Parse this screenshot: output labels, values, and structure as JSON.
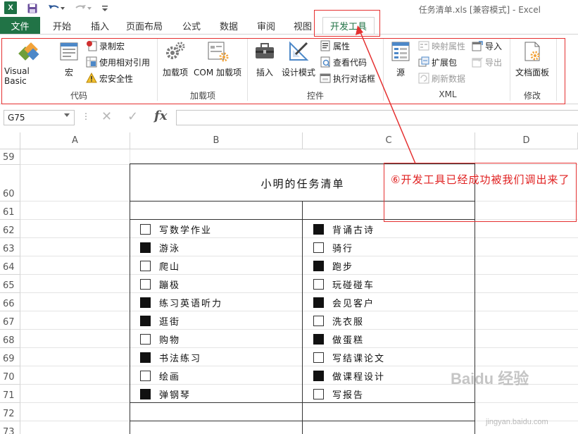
{
  "titlebar": {
    "app_logo": "X",
    "doc_title": "任务清单.xls [兼容模式] - Excel",
    "icons": [
      "save-icon",
      "undo-icon",
      "redo-icon",
      "customize-qa-icon"
    ]
  },
  "tabs": {
    "file": "文件",
    "items": [
      "开始",
      "插入",
      "页面布局",
      "公式",
      "数据",
      "审阅",
      "视图",
      "开发工具"
    ],
    "active": "开发工具"
  },
  "ribbon": {
    "groups": {
      "code": "代码",
      "addins": "加载项",
      "controls": "控件",
      "xml": "XML",
      "modify": "修改"
    },
    "visual_basic": "Visual Basic",
    "macros": "宏",
    "record_macro": "录制宏",
    "relative_ref": "使用相对引用",
    "macro_security": "宏安全性",
    "addins": "加载项",
    "com_addins": "COM 加载项",
    "insert": "插入",
    "design_mode": "设计模式",
    "properties": "属性",
    "view_code": "查看代码",
    "run_dialog": "执行对话框",
    "source": "源",
    "map_properties": "映射属性",
    "expansion_packs": "扩展包",
    "refresh_data": "刷新数据",
    "import": "导入",
    "export": "导出",
    "document_panel": "文档面板"
  },
  "formula_bar": {
    "name_box": "G75",
    "fx": "fx",
    "dots": "⋮",
    "value": ""
  },
  "grid": {
    "columns": [
      "A",
      "B",
      "C",
      "D"
    ],
    "rows": [
      "59",
      "60",
      "61",
      "62",
      "63",
      "64",
      "65",
      "66",
      "67",
      "68",
      "69",
      "70",
      "71",
      "72",
      "73"
    ]
  },
  "task_list": {
    "title": "小明的任务清单",
    "left": [
      {
        "label": "写数学作业",
        "checked": false
      },
      {
        "label": "游泳",
        "checked": true
      },
      {
        "label": "爬山",
        "checked": false
      },
      {
        "label": "蹦极",
        "checked": false
      },
      {
        "label": "练习英语听力",
        "checked": true
      },
      {
        "label": "逛街",
        "checked": true
      },
      {
        "label": "购物",
        "checked": false
      },
      {
        "label": "书法练习",
        "checked": true
      },
      {
        "label": "绘画",
        "checked": false
      },
      {
        "label": "弹钢琴",
        "checked": true
      }
    ],
    "right": [
      {
        "label": "背诵古诗",
        "checked": true
      },
      {
        "label": "骑行",
        "checked": false
      },
      {
        "label": "跑步",
        "checked": true
      },
      {
        "label": "玩碰碰车",
        "checked": false
      },
      {
        "label": "会见客户",
        "checked": true
      },
      {
        "label": "洗衣服",
        "checked": false
      },
      {
        "label": "做蛋糕",
        "checked": true
      },
      {
        "label": "写结课论文",
        "checked": false
      },
      {
        "label": "做课程设计",
        "checked": true
      },
      {
        "label": "写报告",
        "checked": false
      }
    ]
  },
  "annotation": {
    "text": "⑥开发工具已经成功被我们调出来了",
    "color": "#e02020"
  },
  "watermark": {
    "brand": "Baidu 经验",
    "url": "jingyan.baidu.com"
  },
  "colors": {
    "excel_green": "#217346",
    "annotation_red": "#e53030"
  }
}
